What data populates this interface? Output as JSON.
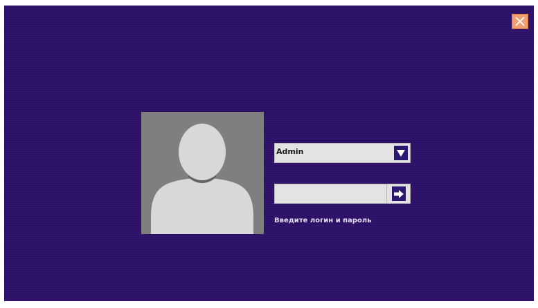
{
  "login": {
    "username": "Admin",
    "password_value": "",
    "hint": "Введите логин и пароль"
  },
  "icons": {
    "close": "close-icon",
    "dropdown": "triangle-down-icon",
    "submit": "arrow-right-icon",
    "avatar": "user-silhouette-icon"
  },
  "colors": {
    "background": "#2d1169",
    "close_button": "#f0a070",
    "avatar_bg": "#7f7f7f",
    "field_bg": "#e3e3e3",
    "icon_bg": "#2c1771",
    "hint_text": "#e4e0f2"
  }
}
